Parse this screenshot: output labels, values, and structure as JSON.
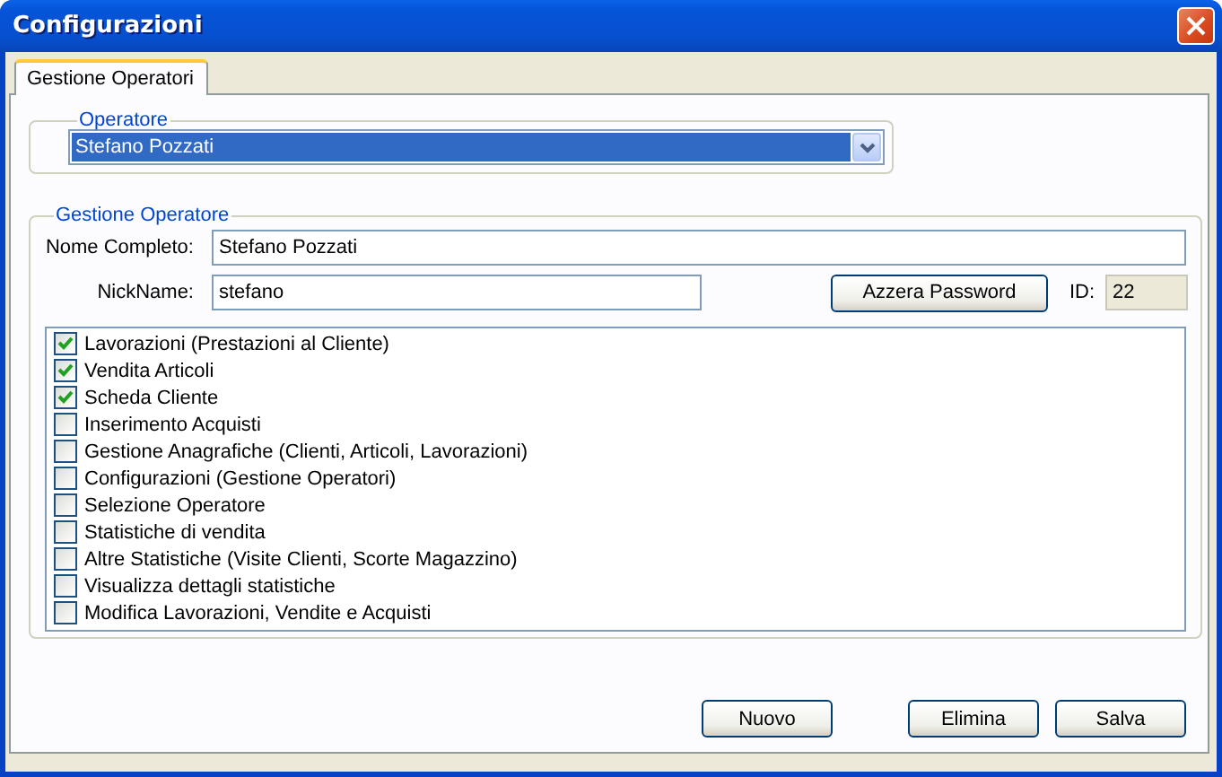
{
  "window": {
    "title": "Configurazioni"
  },
  "tabs": [
    {
      "label": "Gestione Operatori",
      "selected": true
    }
  ],
  "operator_group": {
    "legend": "Operatore",
    "selected_operator": "Stefano Pozzati"
  },
  "operator_management": {
    "legend": "Gestione Operatore",
    "full_name_label": "Nome Completo:",
    "full_name": "Stefano Pozzati",
    "nickname_label": "NickName:",
    "nickname": "stefano",
    "reset_password_button": "Azzera Password",
    "id_label": "ID:",
    "id": "22"
  },
  "permissions": [
    {
      "label": "Lavorazioni (Prestazioni al Cliente)",
      "checked": true
    },
    {
      "label": "Vendita Articoli",
      "checked": true
    },
    {
      "label": "Scheda Cliente",
      "checked": true
    },
    {
      "label": "Inserimento Acquisti",
      "checked": false
    },
    {
      "label": "Gestione Anagrafiche (Clienti, Articoli, Lavorazioni)",
      "checked": false
    },
    {
      "label": "Configurazioni (Gestione Operatori)",
      "checked": false
    },
    {
      "label": "Selezione Operatore",
      "checked": false
    },
    {
      "label": "Statistiche di vendita",
      "checked": false
    },
    {
      "label": "Altre Statistiche (Visite Clienti, Scorte Magazzino)",
      "checked": false
    },
    {
      "label": "Visualizza dettagli statistiche",
      "checked": false
    },
    {
      "label": "Modifica Lavorazioni, Vendite e Acquisti",
      "checked": false
    }
  ],
  "buttons": [
    {
      "label": "Nuovo"
    },
    {
      "label": "Elimina"
    },
    {
      "label": "Salva"
    }
  ]
}
